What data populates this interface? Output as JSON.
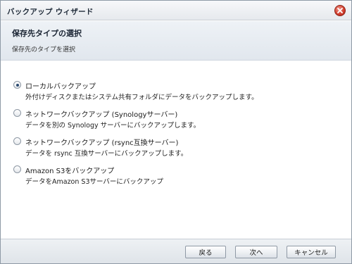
{
  "window": {
    "title": "バックアップ ウィザード",
    "close_icon": "close-icon"
  },
  "header": {
    "title": "保存先タイプの選択",
    "description": "保存先のタイプを選択"
  },
  "options": [
    {
      "label": "ローカルバックアップ",
      "description": "外付けディスクまたはシステム共有フォルダにデータをバックアップします。",
      "selected": true
    },
    {
      "label": "ネットワークバックアップ (Synologyサーバー)",
      "description": "データを別の Synology サーバーにバックアップします。",
      "selected": false
    },
    {
      "label": "ネットワークバックアップ (rsync互換サーバー)",
      "description": "データを rsync 互換サーバーにバックアップします。",
      "selected": false
    },
    {
      "label": "Amazon S3をバックアップ",
      "description": "データをAmazon S3サーバーにバックアップ",
      "selected": false
    }
  ],
  "footer": {
    "back_label": "戻る",
    "next_label": "次へ",
    "cancel_label": "キャンセル"
  },
  "colors": {
    "close_button": "#d03a2a",
    "header_background": "#e6ebf1"
  }
}
